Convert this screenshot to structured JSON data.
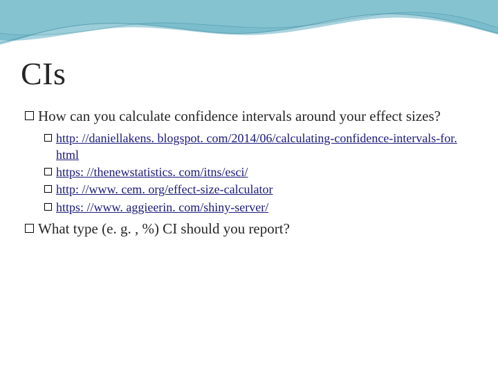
{
  "title": "CIs",
  "bullets": {
    "0": "How can you calculate confidence intervals around your effect sizes?",
    "links": {
      "0": "http: //daniellakens. blogspot. com/2014/06/calculating-confidence-intervals-for. html",
      "1": "https: //thenewstatistics. com/itns/esci/",
      "2": "http: //www. cem. org/effect-size-calculator",
      "3": "https: //www. aggieerin. com/shiny-server/"
    },
    "1": "What type (e. g. , %) CI should you report?"
  }
}
